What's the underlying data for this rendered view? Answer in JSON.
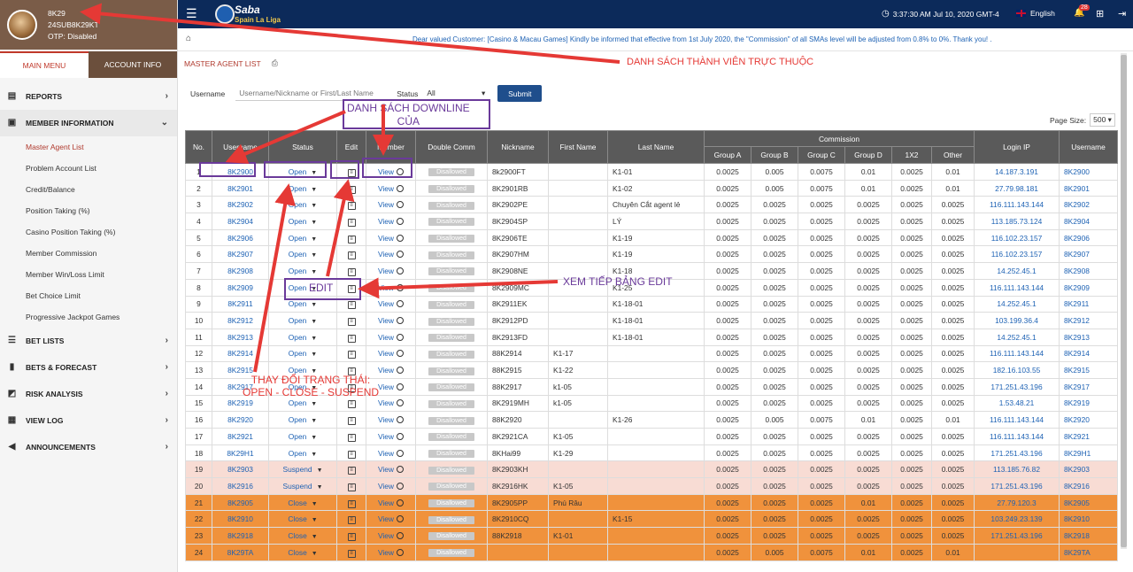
{
  "user": {
    "name": "8K29",
    "account": "24SUB8K29KT",
    "otp": "OTP: Disabled"
  },
  "sidebar": {
    "tabs": [
      "MAIN MENU",
      "ACCOUNT INFO"
    ],
    "sections": [
      {
        "label": "REPORTS",
        "icon": "report-icon"
      },
      {
        "label": "MEMBER INFORMATION",
        "icon": "member-icon"
      },
      {
        "label": "BET LISTS",
        "icon": "list-icon"
      },
      {
        "label": "BETS & FORECAST",
        "icon": "chart-icon"
      },
      {
        "label": "RISK ANALYSIS",
        "icon": "risk-icon"
      },
      {
        "label": "VIEW LOG",
        "icon": "calendar-icon"
      },
      {
        "label": "ANNOUNCEMENTS",
        "icon": "megaphone-icon"
      }
    ],
    "member_items": [
      "Master Agent List",
      "Problem Account List",
      "Credit/Balance",
      "Position Taking (%)",
      "Casino Position Taking (%)",
      "Member Commission",
      "Member Win/Loss Limit",
      "Bet Choice Limit",
      "Progressive Jackpot Games"
    ]
  },
  "topbar": {
    "logo_title": "Saba",
    "logo_subtitle": "Spain La Liga",
    "clock": "3:37:30 AM Jul 10, 2020 GMT-4",
    "language": "English",
    "notification_count": "28"
  },
  "notice": "Dear valued Customer: [Casino & Macau Games] Kindly be informed that effective from 1st July 2020, the \"Commission\" of all SMAs level will be adjusted from 0.8% to 0%. Thank you! .",
  "page": {
    "title": "MASTER AGENT LIST"
  },
  "filter": {
    "username_label": "Username",
    "username_placeholder": "Username/Nickname or First/Last Name",
    "status_label": "Status",
    "status_value": "All",
    "submit": "Submit"
  },
  "pagesize": {
    "label": "Page Size:",
    "value": "500"
  },
  "table": {
    "headers": {
      "no": "No.",
      "username": "Username",
      "status": "Status",
      "edit": "Edit",
      "member": "Member",
      "double_comm": "Double Comm",
      "nickname": "Nickname",
      "first_name": "First Name",
      "last_name": "Last Name",
      "commission": "Commission",
      "login_ip": "Login IP",
      "username2": "Username"
    },
    "commission_headers": [
      "Group A",
      "Group B",
      "Group C",
      "Group D",
      "1X2",
      "Other"
    ],
    "view_label": "View",
    "disallowed_label": "Disallowed",
    "rows": [
      {
        "no": "1",
        "user": "8K2900",
        "status": "Open",
        "nick": "8k2900FT",
        "first": "",
        "last": "K1-01",
        "c": [
          "0.0025",
          "0.005",
          "0.0075",
          "0.01",
          "0.0025",
          "0.01"
        ],
        "ip": "14.187.3.191",
        "type": ""
      },
      {
        "no": "2",
        "user": "8K2901",
        "status": "Open",
        "nick": "8K2901RB",
        "first": "",
        "last": "K1-02",
        "c": [
          "0.0025",
          "0.005",
          "0.0075",
          "0.01",
          "0.0025",
          "0.01"
        ],
        "ip": "27.79.98.181",
        "type": ""
      },
      {
        "no": "3",
        "user": "8K2902",
        "status": "Open",
        "nick": "8K2902PE",
        "first": "",
        "last": "Chuyên Cắt agent lẻ",
        "c": [
          "0.0025",
          "0.0025",
          "0.0025",
          "0.0025",
          "0.0025",
          "0.0025"
        ],
        "ip": "116.111.143.144",
        "type": ""
      },
      {
        "no": "4",
        "user": "8K2904",
        "status": "Open",
        "nick": "8K2904SP",
        "first": "",
        "last": "LÝ",
        "c": [
          "0.0025",
          "0.0025",
          "0.0025",
          "0.0025",
          "0.0025",
          "0.0025"
        ],
        "ip": "113.185.73.124",
        "type": ""
      },
      {
        "no": "5",
        "user": "8K2906",
        "status": "Open",
        "nick": "8K2906TE",
        "first": "",
        "last": "K1-19",
        "c": [
          "0.0025",
          "0.0025",
          "0.0025",
          "0.0025",
          "0.0025",
          "0.0025"
        ],
        "ip": "116.102.23.157",
        "type": ""
      },
      {
        "no": "6",
        "user": "8K2907",
        "status": "Open",
        "nick": "8K2907HM",
        "first": "",
        "last": "K1-19",
        "c": [
          "0.0025",
          "0.0025",
          "0.0025",
          "0.0025",
          "0.0025",
          "0.0025"
        ],
        "ip": "116.102.23.157",
        "type": ""
      },
      {
        "no": "7",
        "user": "8K2908",
        "status": "Open",
        "nick": "8K2908NE",
        "first": "",
        "last": "K1-18",
        "c": [
          "0.0025",
          "0.0025",
          "0.0025",
          "0.0025",
          "0.0025",
          "0.0025"
        ],
        "ip": "14.252.45.1",
        "type": ""
      },
      {
        "no": "8",
        "user": "8K2909",
        "status": "Open",
        "nick": "8K2909MC",
        "first": "",
        "last": "K1-25",
        "c": [
          "0.0025",
          "0.0025",
          "0.0025",
          "0.0025",
          "0.0025",
          "0.0025"
        ],
        "ip": "116.111.143.144",
        "type": ""
      },
      {
        "no": "9",
        "user": "8K2911",
        "status": "Open",
        "nick": "8K2911EK",
        "first": "",
        "last": "K1-18-01",
        "c": [
          "0.0025",
          "0.0025",
          "0.0025",
          "0.0025",
          "0.0025",
          "0.0025"
        ],
        "ip": "14.252.45.1",
        "type": ""
      },
      {
        "no": "10",
        "user": "8K2912",
        "status": "Open",
        "nick": "8K2912PD",
        "first": "",
        "last": "K1-18-01",
        "c": [
          "0.0025",
          "0.0025",
          "0.0025",
          "0.0025",
          "0.0025",
          "0.0025"
        ],
        "ip": "103.199.36.4",
        "type": ""
      },
      {
        "no": "11",
        "user": "8K2913",
        "status": "Open",
        "nick": "8K2913FD",
        "first": "",
        "last": "K1-18-01",
        "c": [
          "0.0025",
          "0.0025",
          "0.0025",
          "0.0025",
          "0.0025",
          "0.0025"
        ],
        "ip": "14.252.45.1",
        "type": ""
      },
      {
        "no": "12",
        "user": "8K2914",
        "status": "Open",
        "nick": "88K2914",
        "first": "K1-17",
        "last": "",
        "c": [
          "0.0025",
          "0.0025",
          "0.0025",
          "0.0025",
          "0.0025",
          "0.0025"
        ],
        "ip": "116.111.143.144",
        "type": ""
      },
      {
        "no": "13",
        "user": "8K2915",
        "status": "Open",
        "nick": "88K2915",
        "first": "K1-22",
        "last": "",
        "c": [
          "0.0025",
          "0.0025",
          "0.0025",
          "0.0025",
          "0.0025",
          "0.0025"
        ],
        "ip": "182.16.103.55",
        "type": ""
      },
      {
        "no": "14",
        "user": "8K2917",
        "status": "Open",
        "nick": "88K2917",
        "first": "k1-05",
        "last": "",
        "c": [
          "0.0025",
          "0.0025",
          "0.0025",
          "0.0025",
          "0.0025",
          "0.0025"
        ],
        "ip": "171.251.43.196",
        "type": ""
      },
      {
        "no": "15",
        "user": "8K2919",
        "status": "Open",
        "nick": "8K2919MH",
        "first": "k1-05",
        "last": "",
        "c": [
          "0.0025",
          "0.0025",
          "0.0025",
          "0.0025",
          "0.0025",
          "0.0025"
        ],
        "ip": "1.53.48.21",
        "type": ""
      },
      {
        "no": "16",
        "user": "8K2920",
        "status": "Open",
        "nick": "88K2920",
        "first": "",
        "last": "K1-26",
        "c": [
          "0.0025",
          "0.005",
          "0.0075",
          "0.01",
          "0.0025",
          "0.01"
        ],
        "ip": "116.111.143.144",
        "type": ""
      },
      {
        "no": "17",
        "user": "8K2921",
        "status": "Open",
        "nick": "8K2921CA",
        "first": "K1-05",
        "last": "",
        "c": [
          "0.0025",
          "0.0025",
          "0.0025",
          "0.0025",
          "0.0025",
          "0.0025"
        ],
        "ip": "116.111.143.144",
        "type": ""
      },
      {
        "no": "18",
        "user": "8K29H1",
        "status": "Open",
        "nick": "8KHai99",
        "first": "K1-29",
        "last": "",
        "c": [
          "0.0025",
          "0.0025",
          "0.0025",
          "0.0025",
          "0.0025",
          "0.0025"
        ],
        "ip": "171.251.43.196",
        "type": ""
      },
      {
        "no": "19",
        "user": "8K2903",
        "status": "Suspend",
        "nick": "8K2903KH",
        "first": "",
        "last": "",
        "c": [
          "0.0025",
          "0.0025",
          "0.0025",
          "0.0025",
          "0.0025",
          "0.0025"
        ],
        "ip": "113.185.76.82",
        "type": "susp"
      },
      {
        "no": "20",
        "user": "8K2916",
        "status": "Suspend",
        "nick": "8K2916HK",
        "first": "K1-05",
        "last": "",
        "c": [
          "0.0025",
          "0.0025",
          "0.0025",
          "0.0025",
          "0.0025",
          "0.0025"
        ],
        "ip": "171.251.43.196",
        "type": "susp"
      },
      {
        "no": "21",
        "user": "8K2905",
        "status": "Close",
        "nick": "8K2905PP",
        "first": "Phú Râu",
        "last": "",
        "c": [
          "0.0025",
          "0.0025",
          "0.0025",
          "0.01",
          "0.0025",
          "0.0025"
        ],
        "ip": "27.79.120.3",
        "type": "close"
      },
      {
        "no": "22",
        "user": "8K2910",
        "status": "Close",
        "nick": "8K2910CQ",
        "first": "",
        "last": "K1-15",
        "c": [
          "0.0025",
          "0.0025",
          "0.0025",
          "0.0025",
          "0.0025",
          "0.0025"
        ],
        "ip": "103.249.23.139",
        "type": "close"
      },
      {
        "no": "23",
        "user": "8K2918",
        "status": "Close",
        "nick": "88K2918",
        "first": "K1-01",
        "last": "",
        "c": [
          "0.0025",
          "0.0025",
          "0.0025",
          "0.0025",
          "0.0025",
          "0.0025"
        ],
        "ip": "171.251.43.196",
        "type": "close"
      },
      {
        "no": "24",
        "user": "8K29TA",
        "status": "Close",
        "nick": "",
        "first": "",
        "last": "",
        "c": [
          "0.0025",
          "0.005",
          "0.0075",
          "0.01",
          "0.0025",
          "0.01"
        ],
        "ip": "",
        "type": "close"
      }
    ]
  },
  "annotations": {
    "subordinates": "DANH SÁCH THÀNH VIÊN TRỰC THUỘC",
    "downline_1": "DANH SÁCH DOWNLINE",
    "downline_2": "CỦA",
    "edit_more": "XEM TIẾP BẢNG EDIT",
    "edit": "EDIT",
    "status_change_1": "THAY ĐỔI TRẠNG THÁI:",
    "status_change_2": "OPEN - CLOSE - SUSPEND"
  },
  "colors": {
    "topbar": "#0c2a5a",
    "accent": "#b03a2e",
    "close_row": "#f0923c",
    "suspend_row": "#f8dcd4",
    "link": "#1e62b4",
    "annotation_red": "#e53935",
    "annotation_purple": "#6a3a9a"
  }
}
